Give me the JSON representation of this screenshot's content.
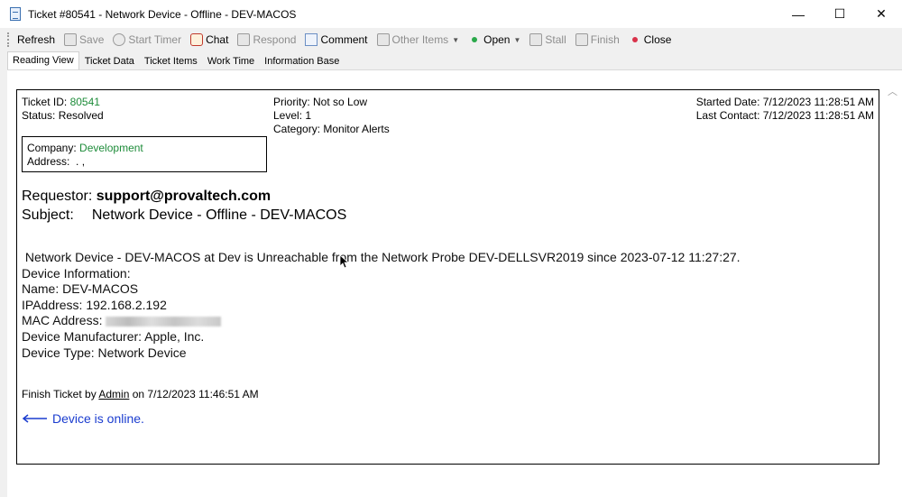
{
  "window": {
    "title": "Ticket #80541 - Network Device - Offline - DEV-MACOS",
    "controls": {
      "minimize": "—",
      "maximize": "☐",
      "close": "✕"
    }
  },
  "toolbar": {
    "refresh": "Refresh",
    "save": "Save",
    "start_timer": "Start Timer",
    "chat": "Chat",
    "respond": "Respond",
    "comment": "Comment",
    "other_items": "Other Items",
    "open": "Open",
    "stall": "Stall",
    "finish": "Finish",
    "close": "Close"
  },
  "tabs": [
    "Reading View",
    "Ticket Data",
    "Ticket Items",
    "Work Time",
    "Information Base"
  ],
  "ticket": {
    "id_label": "Ticket ID:",
    "id": "80541",
    "status_label": "Status:",
    "status": "Resolved",
    "priority_label": "Priority:",
    "priority": "Not so Low",
    "level_label": "Level:",
    "level": "1",
    "category_label": "Category:",
    "category": "Monitor Alerts",
    "started_label": "Started Date:",
    "started": "7/12/2023 11:28:51 AM",
    "last_contact_label": "Last Contact:",
    "last_contact": "7/12/2023 11:28:51 AM",
    "company_label": "Company:",
    "company": "Development",
    "address_label": "Address:",
    "address": ". ,",
    "requestor_label": "Requestor:",
    "requestor": "support@provaltech.com",
    "subject_label": "Subject:",
    "subject": "Network Device - Offline - DEV-MACOS"
  },
  "message": {
    "line1": " Network Device - DEV-MACOS at Dev is Unreachable from the Network Probe DEV-DELLSVR2019 since 2023-07-12 11:27:27.",
    "line2": "Device Information:",
    "line3": "Name: DEV-MACOS",
    "line4": "IPAddress: 192.168.2.192",
    "mac_label": "MAC Address: ",
    "line6": "Device Manufacturer: Apple, Inc.",
    "line7": "Device Type: Network Device"
  },
  "finish": {
    "prefix": "Finish Ticket by ",
    "user": "Admin",
    "suffix": " on 7/12/2023 11:46:51 AM"
  },
  "annotation": {
    "text": "Device is online.",
    "color": "#1a3ccf"
  },
  "colors": {
    "accent_green": "#1e8c3a",
    "close_dot": "#d9324a",
    "open_dot": "#2aa84a"
  }
}
